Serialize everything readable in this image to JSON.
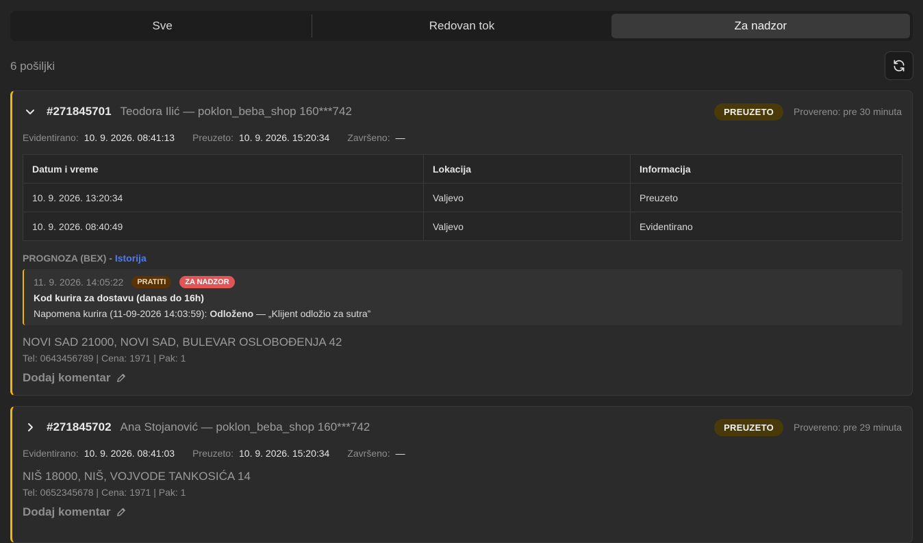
{
  "tabs": [
    {
      "label": "Sve"
    },
    {
      "label": "Redovan tok"
    },
    {
      "label": "Za nadzor"
    }
  ],
  "count_text": "6 pošiljki",
  "accent_color": "#f2b705",
  "link_color": "#4b7bf5",
  "shipments": [
    {
      "id": "#271845701",
      "customer": "Teodora Ilić — poklon_beba_shop 160***742",
      "expanded": true,
      "status": "PREUZETO",
      "checked": "Provereno: pre 30 minuta",
      "dates": {
        "registered_label": "Evidentirano:",
        "registered": "10. 9. 2026. 08:41:13",
        "picked_label": "Preuzeto:",
        "picked": "10. 9. 2026. 15:20:34",
        "done_label": "Završeno:",
        "done": "—"
      },
      "table": {
        "headers": [
          "Datum i vreme",
          "Lokacija",
          "Informacija"
        ],
        "rows": [
          [
            "10. 9. 2026. 13:20:34",
            "Valjevo",
            "Preuzeto"
          ],
          [
            "10. 9. 2026. 08:40:49",
            "Valjevo",
            "Evidentirano"
          ]
        ]
      },
      "prognosis": {
        "label": "PROGNOZA (BEX)",
        "sep": " - ",
        "link": "Istorija",
        "time": "11. 9. 2026. 14:05:22",
        "tag1": "PRATITI",
        "tag2": "ZA NADZOR",
        "title": "Kod kurira za dostavu (danas do 16h)",
        "note_prefix": "Napomena kurira (11-09-2026 14:03:59): ",
        "note_bold": "Odloženo",
        "note_suffix": " — „Klijent odložio za sutra”"
      },
      "address": "NOVI SAD 21000, NOVI SAD, BULEVAR OSLOBOĐENJA 42",
      "meta": "Tel: 0643456789 | Cena: 1971 | Pak: 1",
      "comment": "Dodaj komentar"
    },
    {
      "id": "#271845702",
      "customer": "Ana Stojanović — poklon_beba_shop 160***742",
      "expanded": false,
      "status": "PREUZETO",
      "checked": "Provereno: pre 29 minuta",
      "dates": {
        "registered_label": "Evidentirano:",
        "registered": "10. 9. 2026. 08:41:03",
        "picked_label": "Preuzeto:",
        "picked": "10. 9. 2026. 15:20:34",
        "done_label": "Završeno:",
        "done": "—"
      },
      "address": "NIŠ 18000, NIŠ, VOJVODE TANKOSIĆA 14",
      "meta": "Tel: 0652345678 | Cena: 1971 | Pak: 1",
      "comment": "Dodaj komentar"
    }
  ]
}
